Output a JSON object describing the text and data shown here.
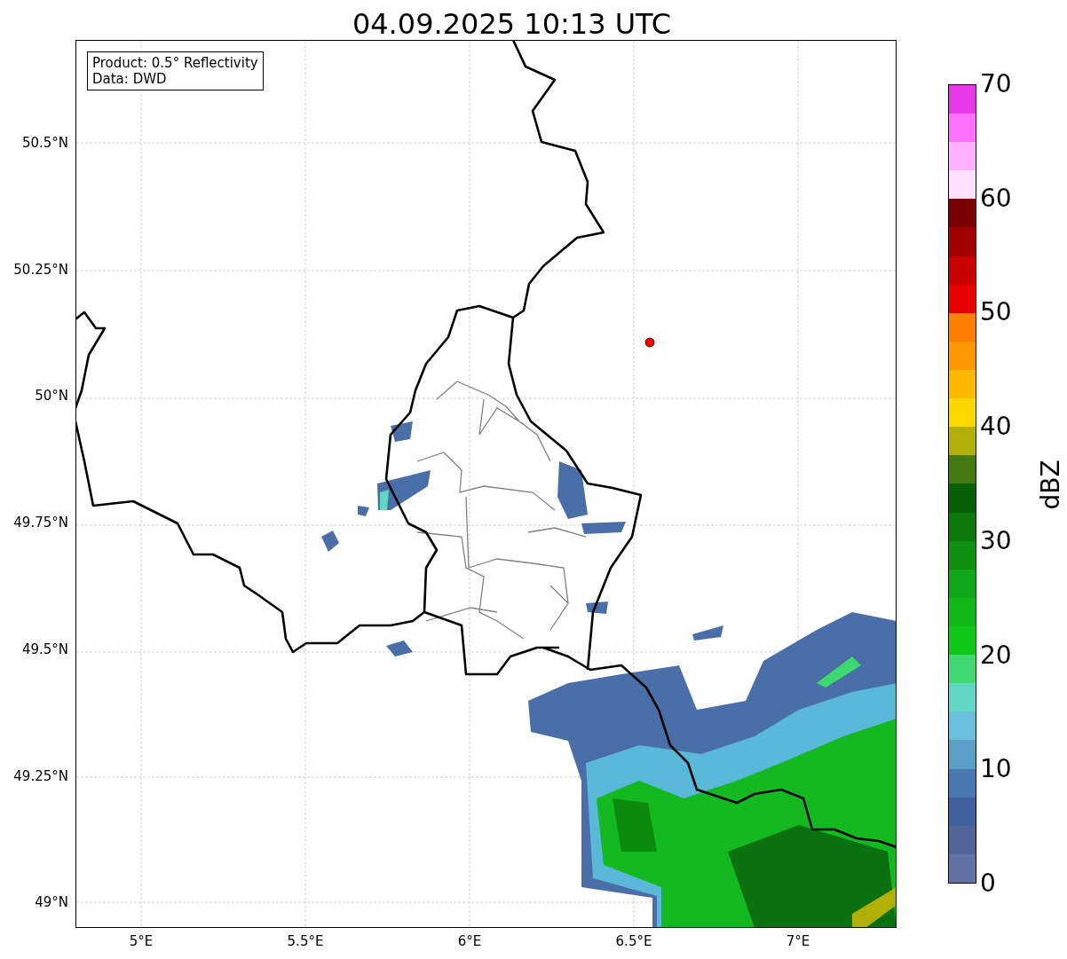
{
  "title": "04.09.2025 10:13 UTC",
  "legend": [
    "Product: 0.5° Reflectivity",
    "Data: DWD"
  ],
  "map": {
    "lat_ticks": [
      "50.5°N",
      "50.25°N",
      "50°N",
      "49.75°N",
      "49.5°N",
      "49.25°N",
      "49°N"
    ],
    "lon_ticks": [
      "5°E",
      "5.5°E",
      "6°E",
      "6.5°E",
      "7°E"
    ]
  },
  "colorbar": {
    "label": "dBZ",
    "ticks": [
      "70",
      "60",
      "50",
      "40",
      "30",
      "20",
      "10",
      "0"
    ],
    "bands": [
      {
        "color": "#6272a4"
      },
      {
        "color": "#52649a"
      },
      {
        "color": "#4060a0"
      },
      {
        "color": "#4a78b0"
      },
      {
        "color": "#5a9fc8"
      },
      {
        "color": "#68c0dc"
      },
      {
        "color": "#60d8c4"
      },
      {
        "color": "#40d870"
      },
      {
        "color": "#10c818"
      },
      {
        "color": "#10b818"
      },
      {
        "color": "#10a818"
      },
      {
        "color": "#109010"
      },
      {
        "color": "#0a780a"
      },
      {
        "color": "#066006"
      },
      {
        "color": "#447a10"
      },
      {
        "color": "#b0b008"
      },
      {
        "color": "#ffd800"
      },
      {
        "color": "#ffb800"
      },
      {
        "color": "#ff9800"
      },
      {
        "color": "#ff8000"
      },
      {
        "color": "#e80000"
      },
      {
        "color": "#c80000"
      },
      {
        "color": "#a00000"
      },
      {
        "color": "#780000"
      },
      {
        "color": "#ffe0ff"
      },
      {
        "color": "#ffb0ff"
      },
      {
        "color": "#ff70ff"
      },
      {
        "color": "#e838e8"
      }
    ]
  }
}
